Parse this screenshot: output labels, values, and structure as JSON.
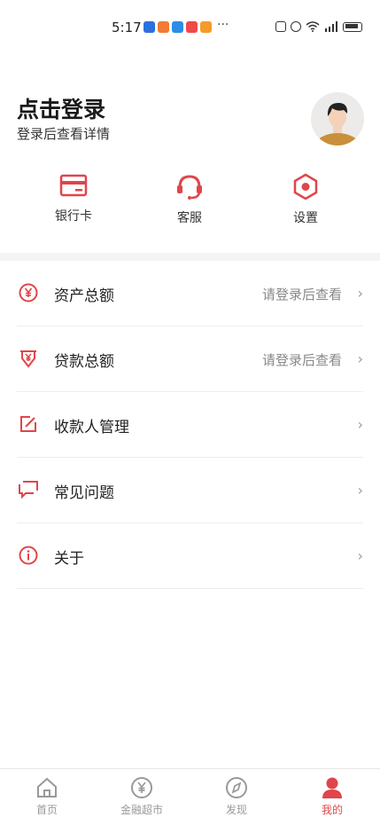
{
  "status_bar": {
    "time": "5:17",
    "more": "···"
  },
  "header": {
    "title": "点击登录",
    "subtitle": "登录后查看详情"
  },
  "quick_actions": [
    {
      "label": "银行卡",
      "icon": "bank-card-icon"
    },
    {
      "label": "客服",
      "icon": "headset-icon"
    },
    {
      "label": "设置",
      "icon": "settings-hexagon-icon"
    }
  ],
  "menu": [
    {
      "label": "资产总额",
      "hint": "请登录后查看",
      "icon": "yuan-circle-icon"
    },
    {
      "label": "贷款总额",
      "hint": "请登录后查看",
      "icon": "loan-yuan-icon"
    },
    {
      "label": "收款人管理",
      "hint": "",
      "icon": "edit-icon"
    },
    {
      "label": "常见问题",
      "hint": "",
      "icon": "chat-icon"
    },
    {
      "label": "关于",
      "hint": "",
      "icon": "info-icon"
    }
  ],
  "bottom_nav": [
    {
      "label": "首页",
      "active": false,
      "icon": "home-icon"
    },
    {
      "label": "金融超市",
      "active": false,
      "icon": "yuan-market-icon"
    },
    {
      "label": "发现",
      "active": false,
      "icon": "compass-icon"
    },
    {
      "label": "我的",
      "active": true,
      "icon": "user-icon"
    }
  ],
  "colors": {
    "accent": "#e0454a",
    "muted": "#999999",
    "divider": "#ededed"
  }
}
